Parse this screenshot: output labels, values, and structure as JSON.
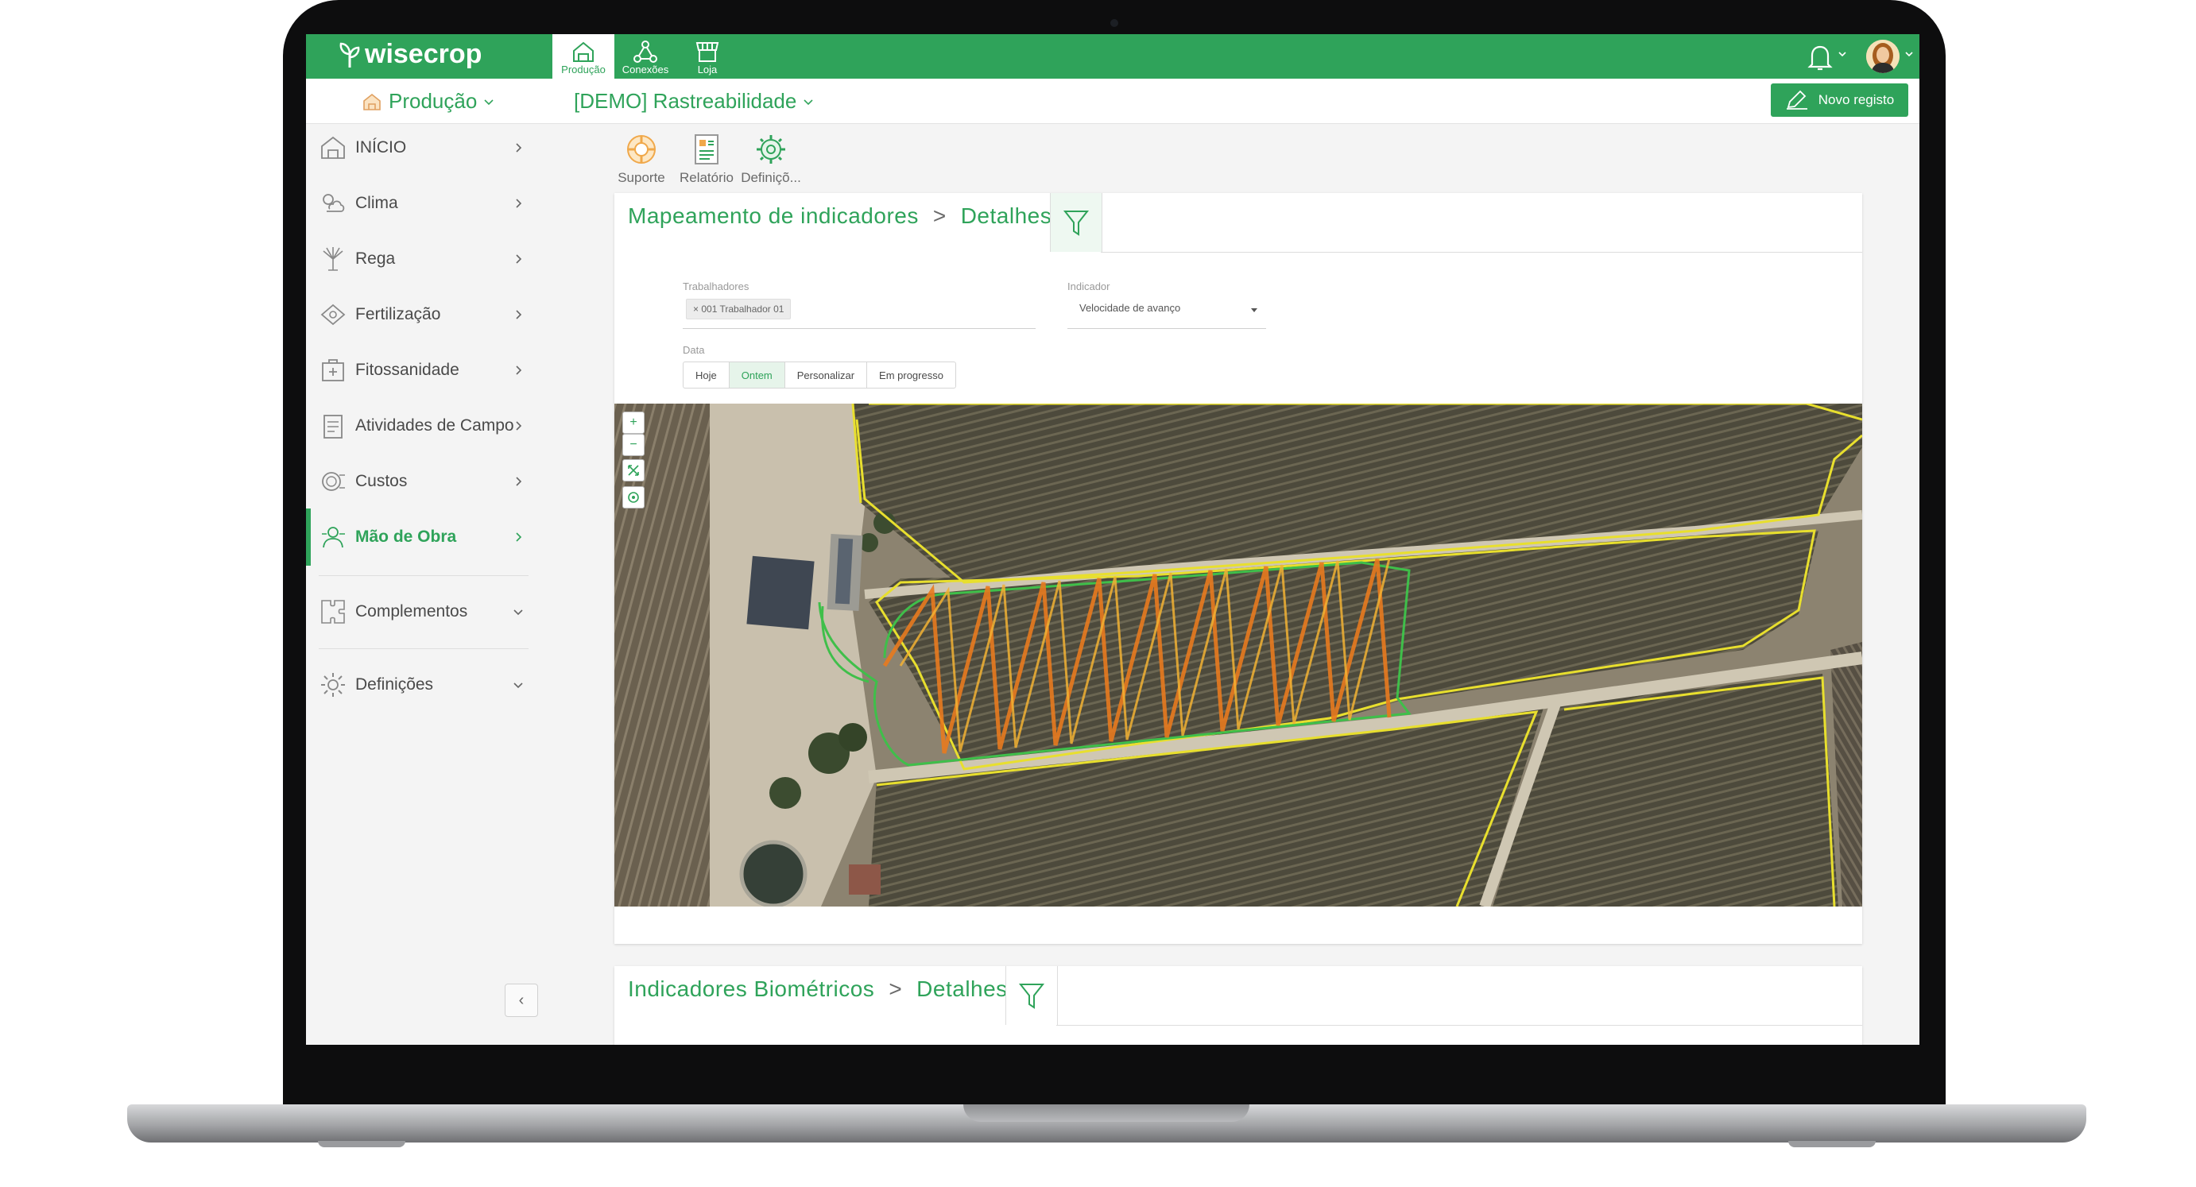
{
  "app": {
    "brand": "wisecrop",
    "nav": [
      {
        "label": "Produção",
        "icon": "farm-icon",
        "active": true
      },
      {
        "label": "Conexões",
        "icon": "network-icon",
        "active": false
      },
      {
        "label": "Loja",
        "icon": "store-icon",
        "active": false
      }
    ],
    "accent": "#2fa35a"
  },
  "header": {
    "module": "Produção",
    "project": "[DEMO] Rastreabilidade",
    "new_record": "Novo registo"
  },
  "sidebar": {
    "items": [
      {
        "label": "INÍCIO",
        "icon": "home-icon"
      },
      {
        "label": "Clima",
        "icon": "cloud-sun-icon"
      },
      {
        "label": "Rega",
        "icon": "sprinkler-icon"
      },
      {
        "label": "Fertilização",
        "icon": "fertilizer-icon"
      },
      {
        "label": "Fitossanidade",
        "icon": "medkit-icon"
      },
      {
        "label": "Atividades de Campo",
        "icon": "clipboard-icon"
      },
      {
        "label": "Custos",
        "icon": "coins-icon"
      },
      {
        "label": "Mão de Obra",
        "icon": "workers-icon",
        "active": true
      },
      {
        "label": "Complementos",
        "icon": "puzzle-icon"
      },
      {
        "label": "Definições",
        "icon": "gear-icon"
      }
    ],
    "collapse": "‹"
  },
  "toolbar": {
    "support": "Suporte",
    "report": "Relatório",
    "settings": "Definiçõ..."
  },
  "card1": {
    "title": "Mapeamento de indicadores",
    "sep": ">",
    "subtitle": "Detalhes",
    "workers_label": "Trabalhadores",
    "worker_chip": "× 001 Trabalhador 01",
    "indicator_label": "Indicador",
    "indicator_value": "Velocidade de avanço",
    "date_label": "Data",
    "date_options": [
      "Hoje",
      "Ontem",
      "Personalizar",
      "Em progresso"
    ],
    "date_selected": "Ontem",
    "zoom_in": "+",
    "zoom_out": "−"
  },
  "card2": {
    "title": "Indicadores Biométricos",
    "sep": ">",
    "subtitle": "Detalhes"
  }
}
